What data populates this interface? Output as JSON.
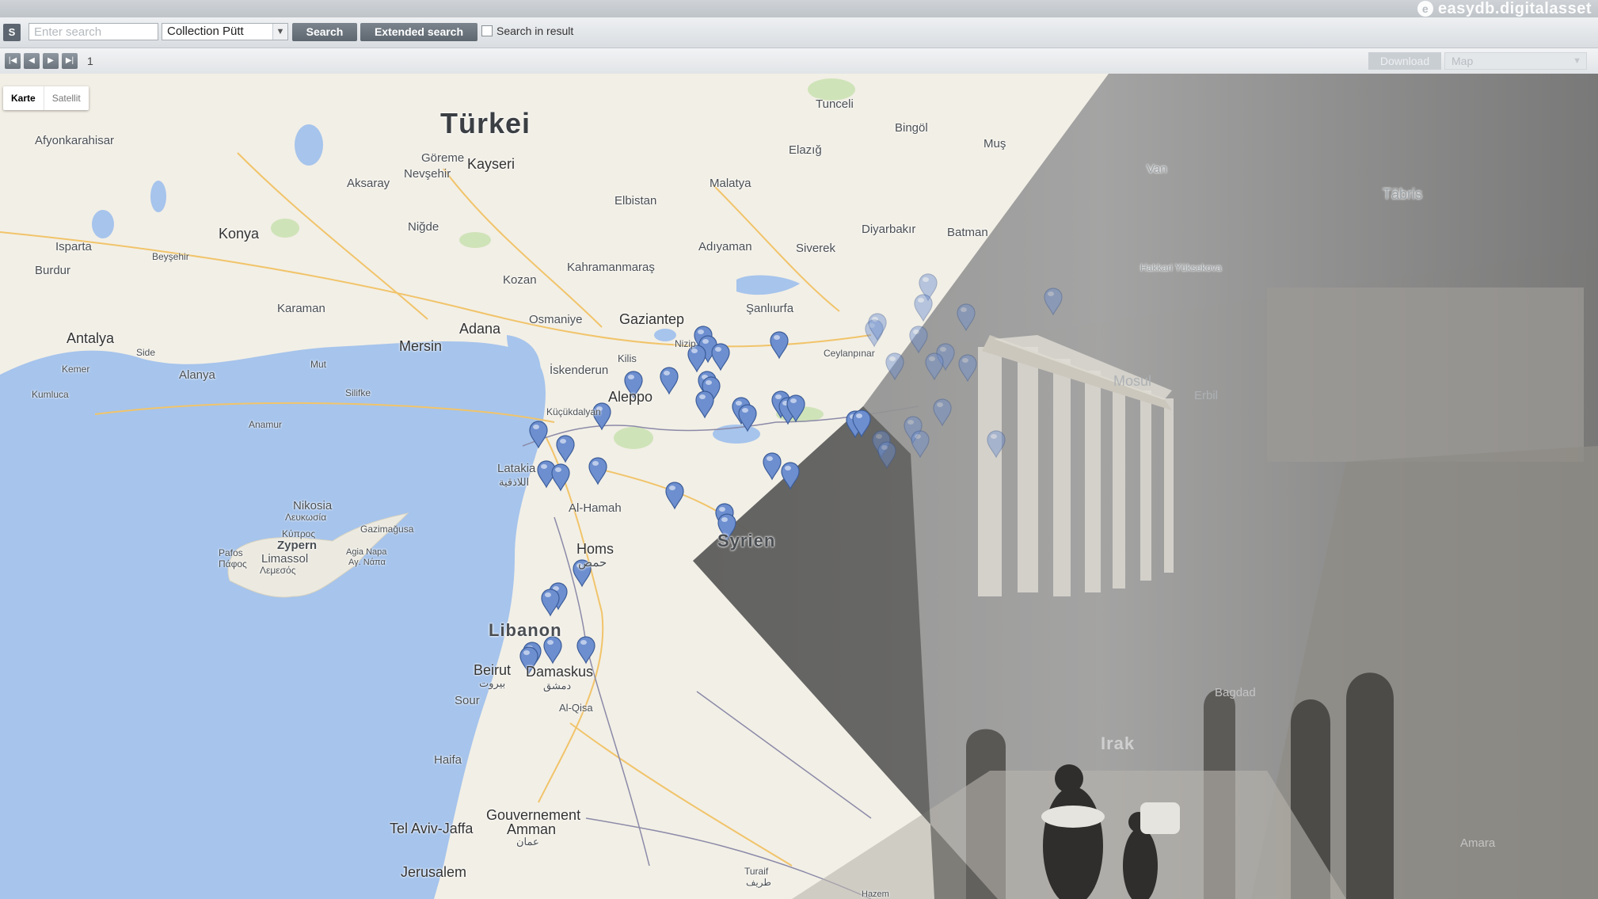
{
  "brand": {
    "name": "easydb.digitalasset",
    "logo_char": "e"
  },
  "search": {
    "s_label": "S",
    "placeholder": "Enter search",
    "collection_value": "Collection Pütt",
    "search_label": "Search",
    "extended_label": "Extended search",
    "in_result_label": "Search in result"
  },
  "pager": {
    "first": "|◀",
    "prev": "◀",
    "next": "▶",
    "last": "▶|",
    "page": "1",
    "download_label": "Download",
    "view_value": "Map"
  },
  "map": {
    "type_control": {
      "map_label": "Karte",
      "satellite_label": "Satellit"
    },
    "countries": {
      "turkey": "Türkei",
      "syria": "Syrien",
      "lebanon": "Libanon",
      "iraq": "Irak",
      "cyprus": "Zypern"
    },
    "seas": {},
    "cities": {
      "afyonkarahisar": "Afyonkarahisar",
      "aksaray": "Aksaray",
      "nevsehir": "Nevşehir",
      "kayseri": "Kayseri",
      "gorem": "Göreme",
      "malatya": "Malatya",
      "elazig": "Elazığ",
      "tunceli": "Tunceli",
      "bingol": "Bingöl",
      "mus": "Muş",
      "konya": "Konya",
      "nigde": "Niğde",
      "elbistan": "Elbistan",
      "isparta": "Isparta",
      "beysehir": "Beyşehir",
      "burdur": "Burdur",
      "adiyaman": "Adıyaman",
      "siverek": "Siverek",
      "diyarbakir": "Diyarbakır",
      "batman": "Batman",
      "kahramanmaras": "Kahramanmaraş",
      "kozan": "Kozan",
      "karaman": "Karaman",
      "gaziantep": "Gaziantep",
      "sanliurfa": "Şanlıurfa",
      "osmaniye": "Osmaniye",
      "adana": "Adana",
      "mersin": "Mersin",
      "antalya": "Antalya",
      "alanya": "Alanya",
      "side": "Side",
      "mut": "Mut",
      "kemer": "Kemer",
      "silifke": "Silifke",
      "kumluca": "Kumluca",
      "anamur": "Anamur",
      "iskenderun": "İskenderun",
      "kilis": "Kilis",
      "nizip": "Nizip",
      "ceylanpinar": "Ceylanpınar",
      "aleppo": "Aleppo",
      "kucukdalyan": "Küçükdalyan",
      "latakia": "Latakia",
      "latakia_ar": "اللاذقية",
      "al_hamah": "Al-Hamah",
      "homs": "Homs",
      "homs_ar": "حمص",
      "nikosia": "Nikosia",
      "nikosia_gr": "Λευκωσία",
      "gazimagusa": "Gazimağusa",
      "agia_napa": "Agia Napa",
      "agia_napa_gr": "Αγ. Νάπα",
      "pafos": "Pafos",
      "pafos_gr": "Πάφος",
      "limassol": "Limassol",
      "limassol_gr": "Λεμεσός",
      "zypern_gr": "Κύπρος",
      "beirut": "Beirut",
      "beirut_ar": "بيروت",
      "damaskus": "Damaskus",
      "damaskus_ar": "دمشق",
      "sour": "Sour",
      "al_qisa": "Al-Qisa",
      "haifa": "Haifa",
      "tel_aviv": "Tel Aviv-Jaffa",
      "gouvernement": "Gouvernement",
      "amman": "Amman",
      "amman_ar": "عمان",
      "jerusalem": "Jerusalem",
      "turaif": "Turaif",
      "turaif_ar": "طريف",
      "van": "Van",
      "tabris": "Täbris",
      "mosul": "Mosul",
      "erbil": "Erbil",
      "hakkari": "Hakkari Yüksekova",
      "baghdad": "Bagdad",
      "amara": "Amara",
      "hazem": "Hazem"
    },
    "pin_count": 52,
    "pins_color": "#6d8fd0",
    "sea_color": "#a5c3ec",
    "land_color": "#f3efe6",
    "overlay_color": "#7b7b7b"
  }
}
